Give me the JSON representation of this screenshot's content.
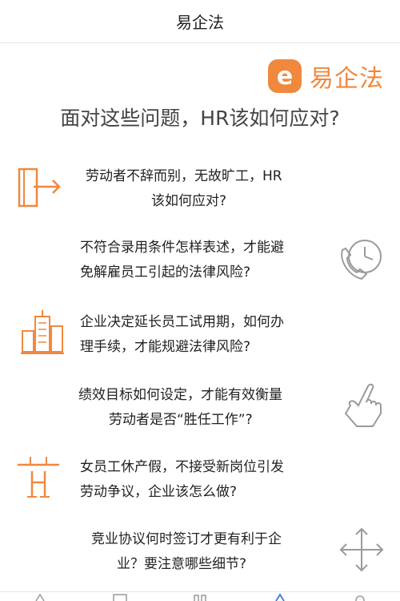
{
  "header": {
    "title": "易企法"
  },
  "logo": {
    "mark": "e",
    "name": "易企法"
  },
  "heading": "面对这些问题，HR该如何应对?",
  "items": [
    {
      "line1": "劳动者不辞而别，无故旷工，HR",
      "line2": "该如何应对?",
      "icon": "exit-door-icon"
    },
    {
      "line1": "不符合录用条件怎样表述，才能避",
      "line2": "免解雇员工引起的法律风险?",
      "icon": "clock-phone-icon"
    },
    {
      "line1": "企业决定延长员工试用期，如何办",
      "line2": "理手续，才能规避法律风险?",
      "icon": "office-building-icon"
    },
    {
      "line1": "绩效目标如何设定，才能有效衡量",
      "line2": "劳动者是否“胜任工作”?",
      "icon": "pointing-hand-icon"
    },
    {
      "line1": "女员工休产假，不接受新岗位引发",
      "line2": "劳动争议，企业该怎么做?",
      "icon": "person-figure-icon"
    },
    {
      "line1": "竞业协议何时签订才更有利于企",
      "line2": "业？要注意哪些细节?",
      "icon": "move-arrows-icon"
    }
  ],
  "colors": {
    "accent": "#f0883e",
    "gray_icon": "#9a9a9a"
  }
}
